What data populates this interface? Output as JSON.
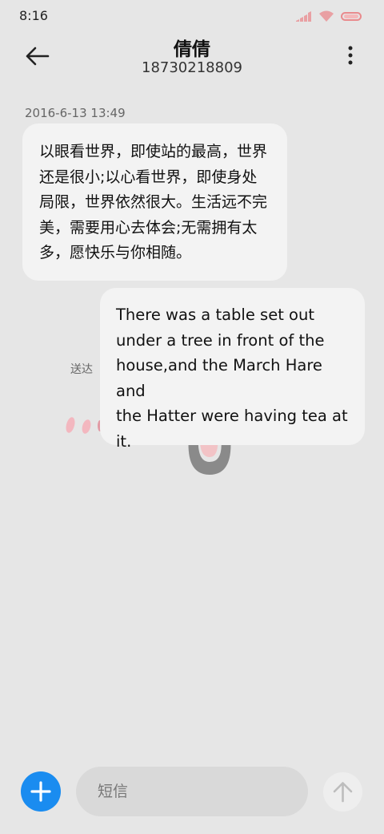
{
  "status_bar": {
    "time": "8:16",
    "icons": [
      "signal-icon",
      "wifi-icon",
      "battery-icon"
    ]
  },
  "header": {
    "contact_name": "倩倩",
    "phone_number": "18730218809",
    "back_icon": "arrow-left-icon",
    "more_icon": "more-vertical-icon"
  },
  "conversation": {
    "timestamp": "2016-6-13 13:49",
    "messages": [
      {
        "direction": "incoming",
        "lines": [
          "以眼看世界，即使站的最高，世界",
          "还是很小;以心看世界，即使身处",
          "局限，世界依然很大。生活远不完",
          "美，需要用心去体会;无需拥有太",
          "多，愿快乐与你相随。"
        ]
      },
      {
        "direction": "outgoing",
        "lines": [
          "There was a table set out",
          "under a tree in front of the",
          "house,and the March Hare and",
          "the Hatter were having tea at",
          "it."
        ],
        "status": "送达"
      }
    ]
  },
  "composer": {
    "placeholder": "短信",
    "add_icon": "plus-icon",
    "send_icon": "arrow-up-icon"
  },
  "colors": {
    "background": "#e6e6e6",
    "bubble": "#f3f3f3",
    "accent": "#1a8cf0",
    "input_bg": "#d9d9d9"
  }
}
